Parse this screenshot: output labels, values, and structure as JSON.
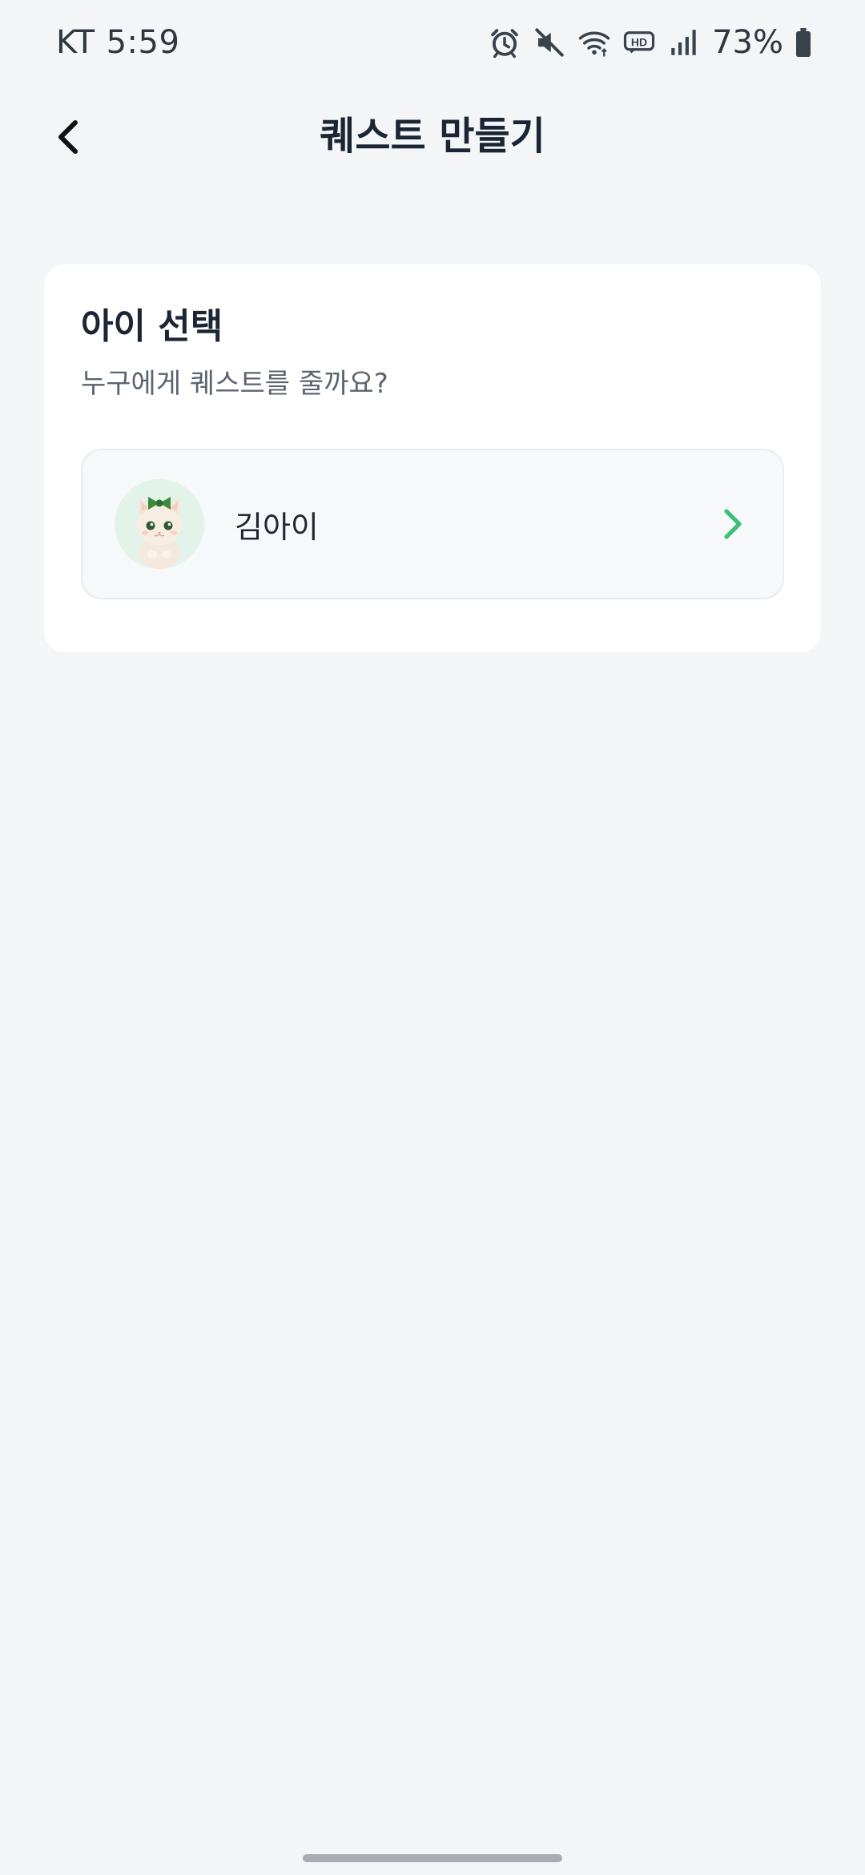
{
  "status_bar": {
    "carrier": "KT",
    "time": "5:59",
    "battery": "73%",
    "icons": [
      "alarm-icon",
      "mute-icon",
      "wifi-icon",
      "hd-voice-icon",
      "signal-icon",
      "battery-icon"
    ]
  },
  "header": {
    "title": "퀘스트 만들기",
    "back_icon": "chevron-left-icon"
  },
  "child_select": {
    "title": "아이 선택",
    "subtitle": "누구에게 퀘스트를 줄까요?",
    "children": [
      {
        "name": "김아이",
        "avatar": "cat-avatar",
        "action_icon": "chevron-right-icon"
      }
    ]
  },
  "colors": {
    "background": "#f3f5f7",
    "card": "#ffffff",
    "accent": "#3fbf78",
    "title": "#1c2533"
  }
}
